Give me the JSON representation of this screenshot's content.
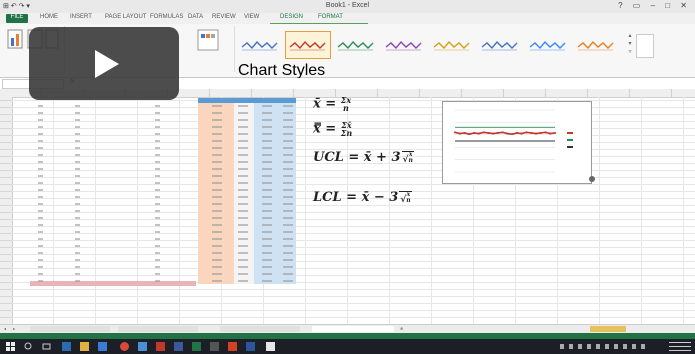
{
  "window": {
    "title": "Book1 - Excel",
    "quick_access": "⊞ ↶ ↷ ▾",
    "controls": "? ▭ – □ ✕"
  },
  "ribbon": {
    "file_tab": "FILE",
    "tabs": [
      "HOME",
      "INSERT",
      "PAGE LAYOUT",
      "FORMULAS",
      "DATA",
      "REVIEW",
      "VIEW",
      "DESIGN",
      "FORMAT"
    ],
    "chart_styles_label": "Chart Styles",
    "style_count": 8
  },
  "formulas": {
    "mean": "x̄ = Σx / n",
    "grand_mean": "x̿ = Σx̄ / Σn",
    "ucl_label": "UCL",
    "lcl_label": "LCL",
    "ucl": "UCL = x̄ + 3√(x̄/n)",
    "lcl": "LCL = x̄ − 3√(x̄/n)"
  },
  "chart_data": {
    "type": "line",
    "series": [
      {
        "values": [
          0.64,
          0.62,
          0.63,
          0.61,
          0.63,
          0.62,
          0.64,
          0.63,
          0.62,
          0.63,
          0.64,
          0.62,
          0.61,
          0.63,
          0.62,
          0.64,
          0.63,
          0.62,
          0.63,
          0.64,
          0.62,
          0.63
        ]
      },
      {
        "values": [
          0.72,
          0.72,
          0.72,
          0.72,
          0.72,
          0.72,
          0.72,
          0.72,
          0.72,
          0.72,
          0.72,
          0.72,
          0.72,
          0.72,
          0.72,
          0.72,
          0.72,
          0.72,
          0.72,
          0.72,
          0.72,
          0.72
        ]
      },
      {
        "values": [
          0.5,
          0.5,
          0.5,
          0.5,
          0.5,
          0.5,
          0.5,
          0.5,
          0.5,
          0.5,
          0.5,
          0.5,
          0.5,
          0.5,
          0.5,
          0.5,
          0.5,
          0.5,
          0.5,
          0.5,
          0.5,
          0.5
        ]
      }
    ],
    "colors": [
      "#c0392b",
      "#2e8b57",
      "#333333"
    ],
    "ylim": [
      0,
      1
    ]
  },
  "colors": {
    "excel_green": "#217346",
    "orange_fill": "#f9d6bd",
    "blue_fill": "#cfe2f3",
    "taskbar": "#1c1f26"
  },
  "video": {
    "play_icon": "play-icon"
  }
}
